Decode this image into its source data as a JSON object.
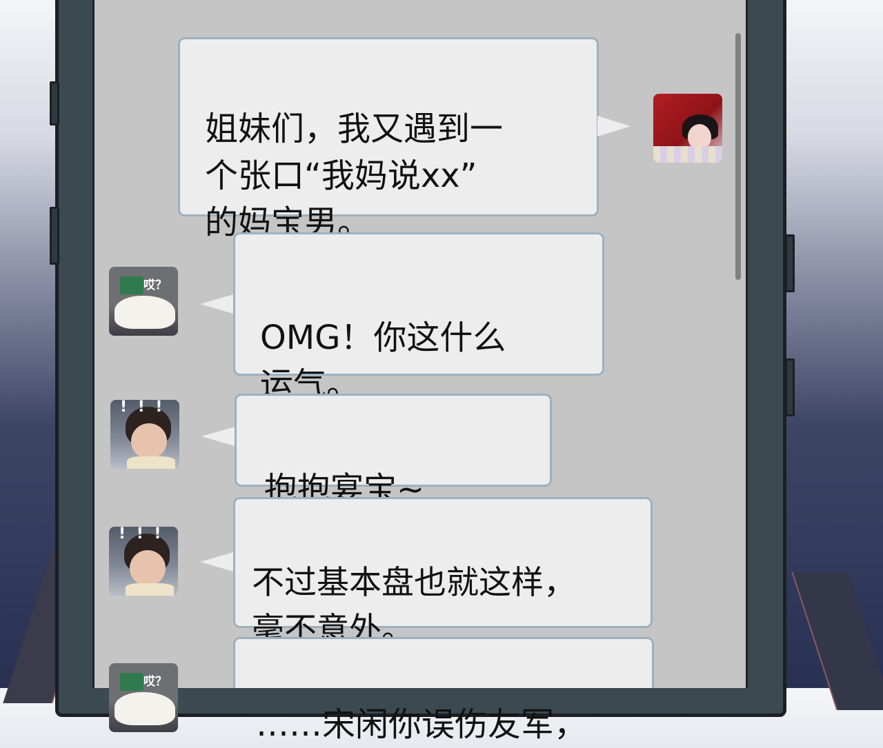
{
  "chat": {
    "messages": [
      {
        "sender": "me",
        "text": "姐妹们，我又遇到一\n个张口“我妈说xx”\n的妈宝男。"
      },
      {
        "sender": "dog",
        "text": "OMG！你这什么\n运气。"
      },
      {
        "sender": "baby",
        "text": "抱抱宴宝~"
      },
      {
        "sender": "baby",
        "text": "不过基本盘也就这样，\n毫不意外。"
      },
      {
        "sender": "dog",
        "text": "……宋闲你误伤友军，"
      }
    ],
    "avatars": {
      "dog_caption": "哎？",
      "baby_marks": "! ! !"
    }
  },
  "colors": {
    "chat_background": "#c5c5c5",
    "bubble_fill": "#ededed",
    "bubble_border": "#9cb0c0",
    "phone_frame": "#3b4a51"
  }
}
